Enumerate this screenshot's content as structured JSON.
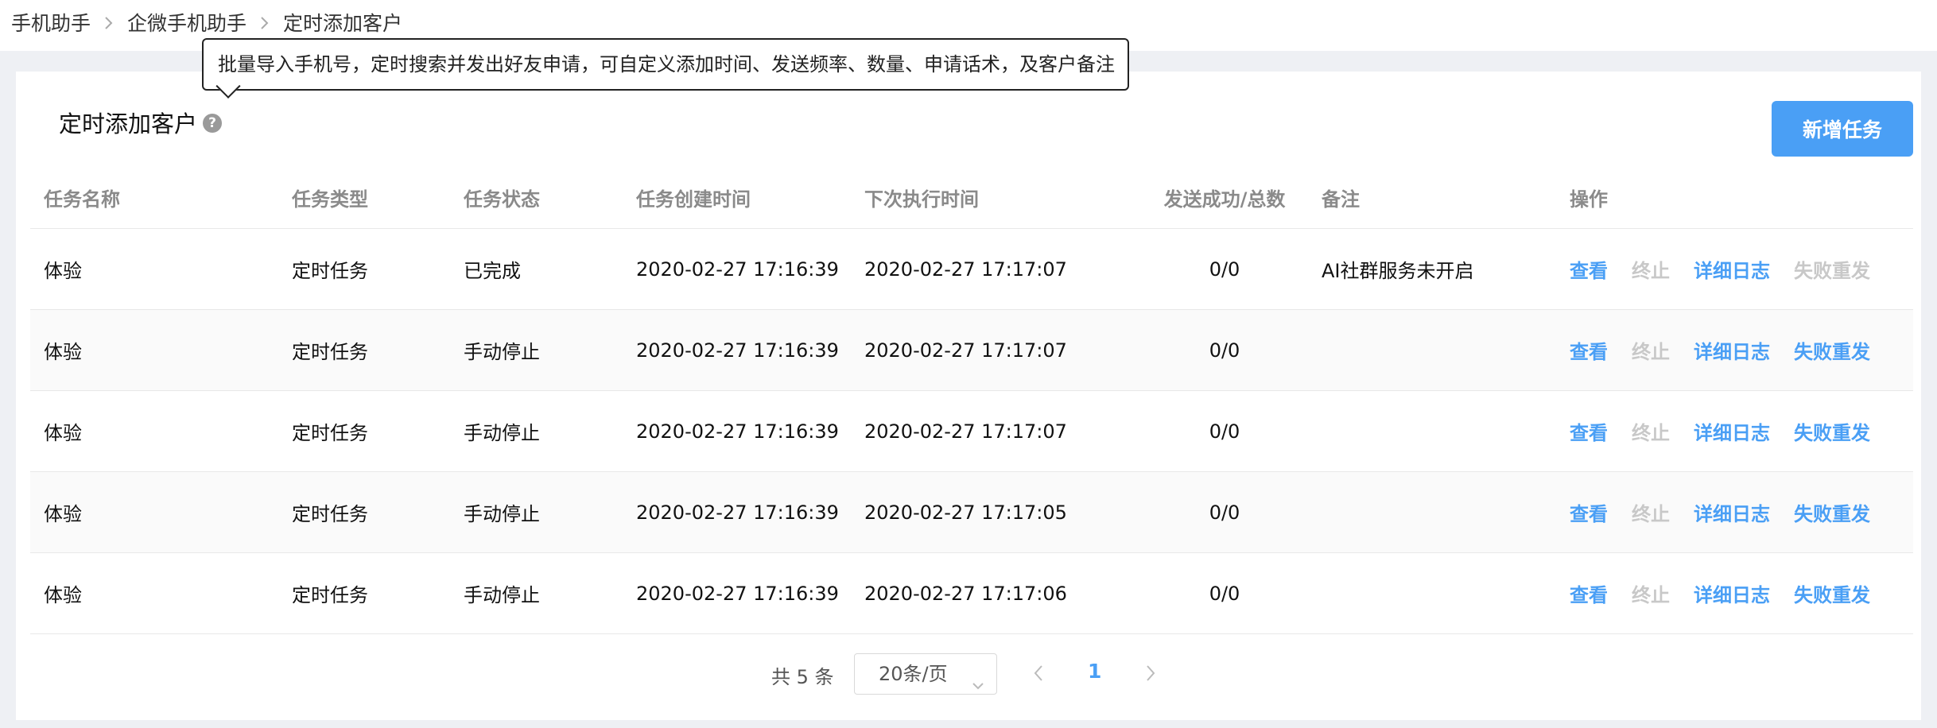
{
  "breadcrumb": {
    "items": [
      "手机助手",
      "企微手机助手",
      "定时添加客户"
    ]
  },
  "tooltip": {
    "text": "批量导入手机号，定时搜索并发出好友申请，可自定义添加时间、发送频率、数量、申请话术，及客户备注"
  },
  "header": {
    "title": "定时添加客户",
    "help_icon": "question-circle-icon",
    "add_button": "新增任务"
  },
  "table": {
    "columns": [
      "任务名称",
      "任务类型",
      "任务状态",
      "任务创建时间",
      "下次执行时间",
      "发送成功/总数",
      "备注",
      "操作"
    ],
    "rows": [
      {
        "name": "体验",
        "type": "定时任务",
        "status": "已完成",
        "created": "2020-02-27 17:16:39",
        "next": "2020-02-27 17:17:07",
        "count": "0/0",
        "note": "AI社群服务未开启",
        "resend_enabled": false
      },
      {
        "name": "体验",
        "type": "定时任务",
        "status": "手动停止",
        "created": "2020-02-27 17:16:39",
        "next": "2020-02-27 17:17:07",
        "count": "0/0",
        "note": "",
        "resend_enabled": true
      },
      {
        "name": "体验",
        "type": "定时任务",
        "status": "手动停止",
        "created": "2020-02-27 17:16:39",
        "next": "2020-02-27 17:17:07",
        "count": "0/0",
        "note": "",
        "resend_enabled": true
      },
      {
        "name": "体验",
        "type": "定时任务",
        "status": "手动停止",
        "created": "2020-02-27 17:16:39",
        "next": "2020-02-27 17:17:05",
        "count": "0/0",
        "note": "",
        "resend_enabled": true
      },
      {
        "name": "体验",
        "type": "定时任务",
        "status": "手动停止",
        "created": "2020-02-27 17:16:39",
        "next": "2020-02-27 17:17:06",
        "count": "0/0",
        "note": "",
        "resend_enabled": true
      }
    ],
    "actions": {
      "view": "查看",
      "stop": "终止",
      "log": "详细日志",
      "resend": "失败重发"
    }
  },
  "pagination": {
    "total_text": "共 5 条",
    "page_size": "20条/页",
    "current_page": "1"
  },
  "colors": {
    "accent": "#4a9ff5",
    "disabled": "#c8c8c8"
  }
}
